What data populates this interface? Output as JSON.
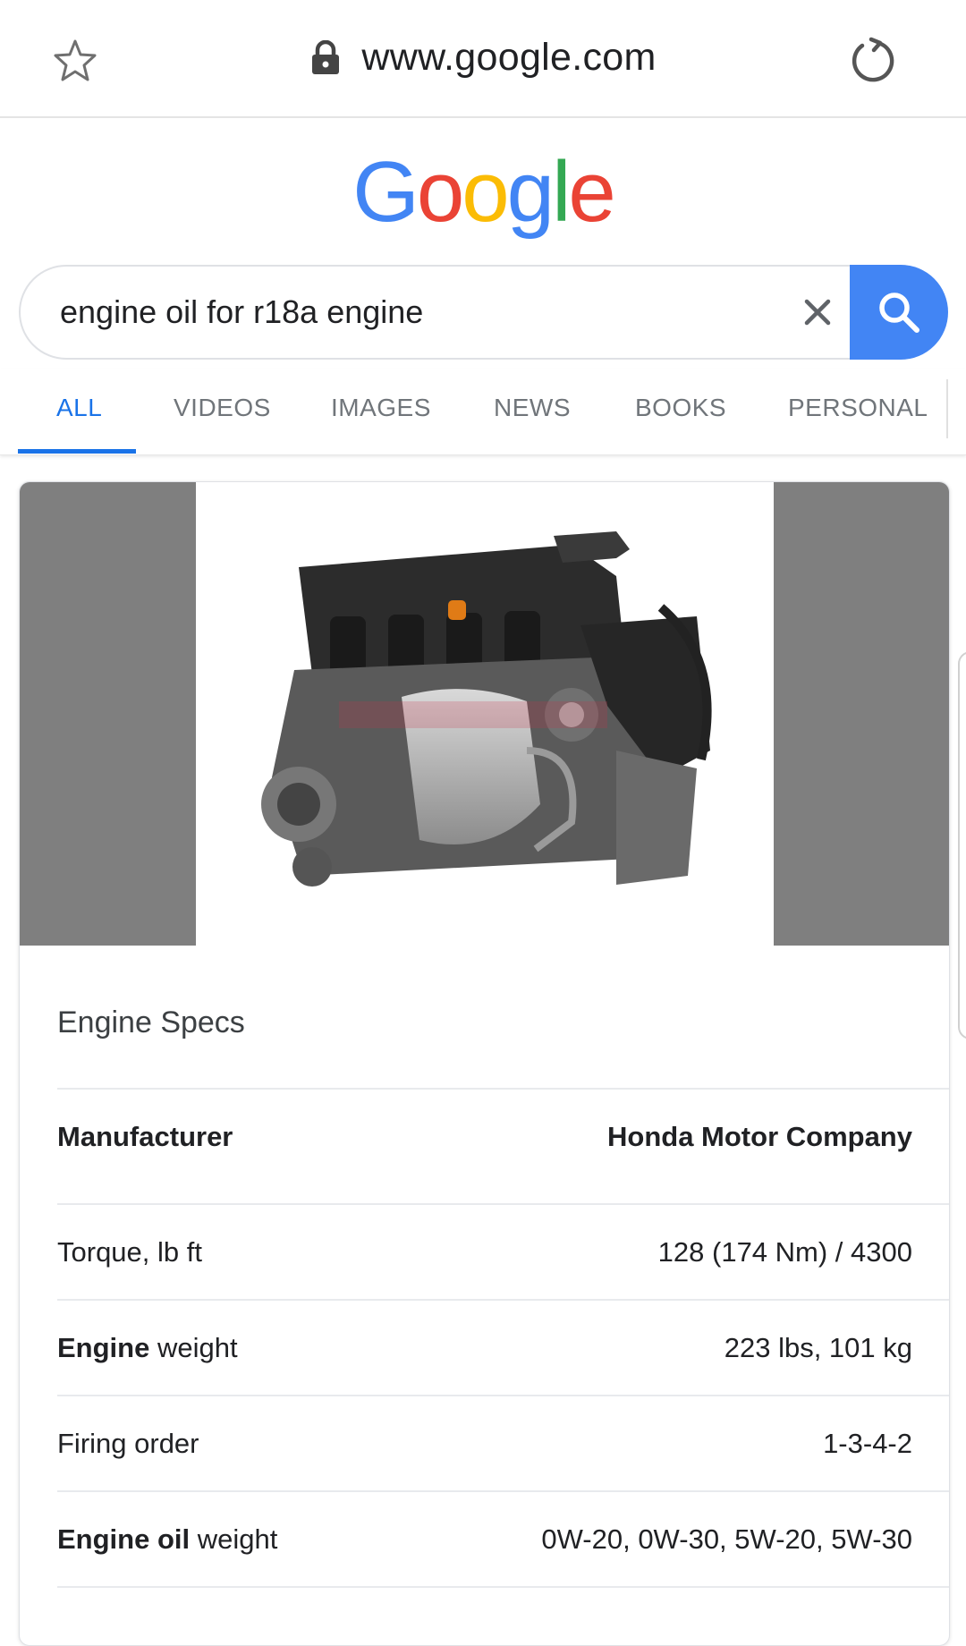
{
  "browser": {
    "url": "www.google.com"
  },
  "logo": {
    "letters": [
      "G",
      "o",
      "o",
      "g",
      "l",
      "e"
    ],
    "colors": [
      "#4285f4",
      "#ea4335",
      "#fbbc05",
      "#4285f4",
      "#34a853",
      "#ea4335"
    ]
  },
  "search": {
    "query": "engine oil for r18a engine"
  },
  "tabs": [
    {
      "label": "ALL",
      "active": true
    },
    {
      "label": "VIDEOS",
      "active": false
    },
    {
      "label": "IMAGES",
      "active": false
    },
    {
      "label": "NEWS",
      "active": false
    },
    {
      "label": "BOOKS",
      "active": false
    },
    {
      "label": "PERSONAL",
      "active": false
    }
  ],
  "card": {
    "title": "Engine Specs",
    "rows": [
      {
        "key": "Manufacturer",
        "key_bold": "",
        "value": "Honda Motor Company"
      },
      {
        "key": "Torque, lb ft",
        "key_bold": "",
        "value": "128 (174 Nm) / 4300"
      },
      {
        "key": " weight",
        "key_bold": "Engine",
        "value": "223 lbs, 101 kg"
      },
      {
        "key": "Firing order",
        "key_bold": "",
        "value": "1-3-4-2"
      },
      {
        "key": " weight",
        "key_bold": "Engine oil",
        "value": "0W-20, 0W-30, 5W-20, 5W-30"
      }
    ]
  },
  "colors": {
    "accent": "#1a73e8",
    "search_button": "#4285f4",
    "image_side": "#7f7f7f"
  },
  "icons": [
    "star-icon",
    "lock-icon",
    "reload-icon",
    "clear-icon",
    "search-icon"
  ]
}
